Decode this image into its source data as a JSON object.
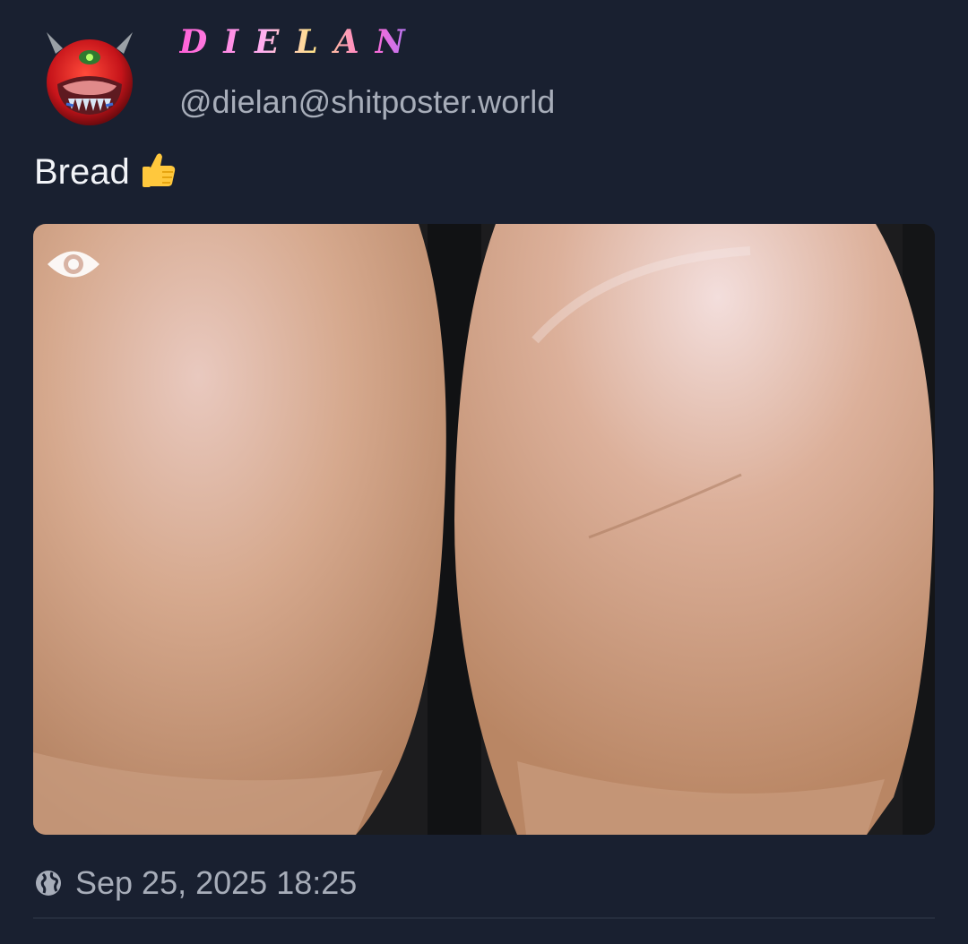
{
  "author": {
    "display_name": "DIELAN",
    "handle": "@dielan@shitposter.world",
    "avatar_icon": "cacodemon-avatar-icon"
  },
  "post": {
    "text": "Bread",
    "emoji": "thumbs-up-icon"
  },
  "media": {
    "type": "image",
    "overlay_icon": "eye-icon"
  },
  "footer": {
    "visibility_icon": "globe-icon",
    "timestamp": "Sep 25, 2025 18:25"
  },
  "colors": {
    "background": "#192030",
    "secondary_text": "#a7adb9",
    "primary_text": "#f2f4f8"
  }
}
